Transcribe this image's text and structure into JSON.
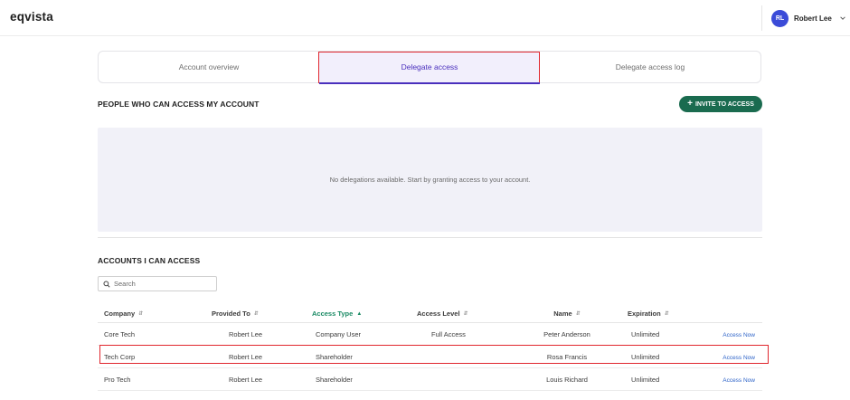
{
  "app": {
    "logo": "eqvista"
  },
  "user": {
    "initials": "RL",
    "name": "Robert Lee"
  },
  "tabs": [
    {
      "label": "Account overview",
      "active": false
    },
    {
      "label": "Delegate access",
      "active": true
    },
    {
      "label": "Delegate access log",
      "active": false
    }
  ],
  "people_section": {
    "title": "PEOPLE WHO CAN ACCESS MY ACCOUNT",
    "invite_label": "INVITE TO ACCESS",
    "empty_message": "No delegations available. Start by granting access to your account."
  },
  "accounts_section": {
    "title": "ACCOUNTS I CAN ACCESS",
    "search_placeholder": "Search"
  },
  "table": {
    "columns": [
      "Company",
      "Provided To",
      "Access Type",
      "Access Level",
      "Name",
      "Expiration"
    ],
    "sorted_column": "Access Type",
    "rows": [
      {
        "company": "Core Tech",
        "provided_to": "Robert Lee",
        "access_type": "Company User",
        "access_level": "Full Access",
        "name": "Peter Anderson",
        "expiration": "Unlimited",
        "action": "Access Now",
        "highlighted": false
      },
      {
        "company": "Tech Corp",
        "provided_to": "Robert Lee",
        "access_type": "Shareholder",
        "access_level": "",
        "name": "Rosa Francis",
        "expiration": "Unlimited",
        "action": "Access Now",
        "highlighted": true
      },
      {
        "company": "Pro Tech",
        "provided_to": "Robert Lee",
        "access_type": "Shareholder",
        "access_level": "",
        "name": "Louis Richard",
        "expiration": "Unlimited",
        "action": "Access Now",
        "highlighted": false
      }
    ]
  },
  "colors": {
    "brand_green": "#1a6b4f",
    "accent_purple": "#4a2fbd",
    "avatar_blue": "#3b4bd8",
    "highlight_red": "#e0262d",
    "link_blue": "#2d63c8"
  }
}
